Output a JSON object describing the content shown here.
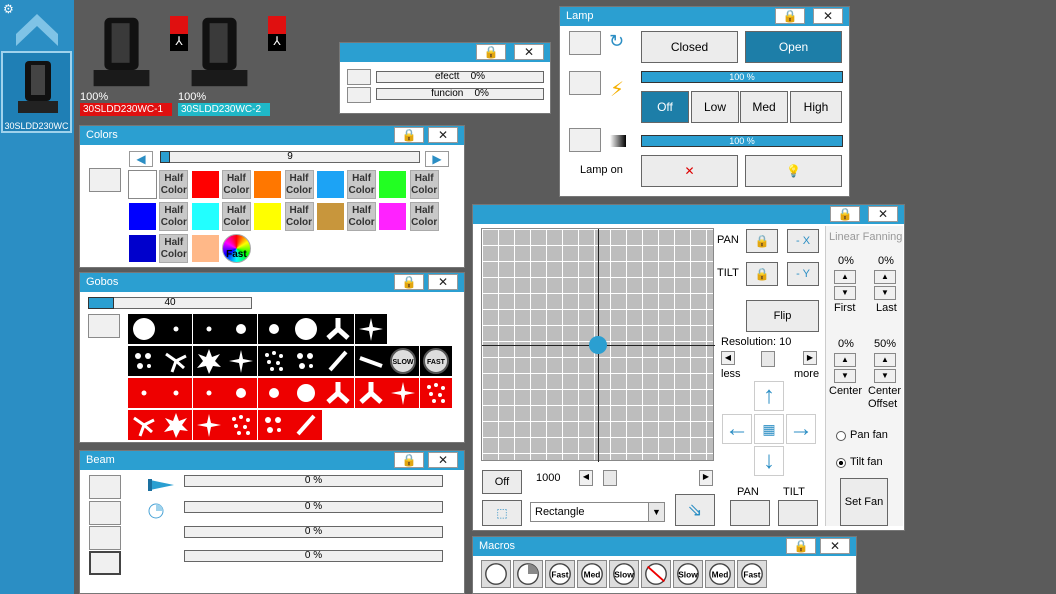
{
  "sidebar": {
    "fixture_label": "30SLDD230WC"
  },
  "fixtures": [
    {
      "percent": "100%",
      "name": "30SLDD230WC-1",
      "color": "#e01010"
    },
    {
      "percent": "100%",
      "name": "30SLDD230WC-2",
      "color": "#1fb8c8"
    }
  ],
  "effects": {
    "rows": [
      {
        "label": "efectt",
        "value": "0%"
      },
      {
        "label": "funcion",
        "value": "0%"
      }
    ]
  },
  "colors": {
    "title": "Colors",
    "value": "9",
    "half_label": "Half\nColor",
    "fast_label": "Fast",
    "swatches": [
      "#ffffff",
      "#ff0000",
      "#ff7700",
      "#1ca3f5",
      "#22ff22",
      "#0000ff",
      "#22ffff",
      "#ffff00",
      "#c8963c",
      "#ff22ff",
      "#0000cc",
      "#ffb888"
    ]
  },
  "gobos": {
    "title": "Gobos",
    "value": "40",
    "slow": "SLOW",
    "fast": "FAST"
  },
  "beam": {
    "title": "Beam",
    "values": [
      "0 %",
      "0 %",
      "0 %",
      "0 %"
    ]
  },
  "lamp": {
    "title": "Lamp",
    "closed": "Closed",
    "open": "Open",
    "bar1": "100 %",
    "bar2": "100 %",
    "off": "Off",
    "low": "Low",
    "med": "Med",
    "high": "High",
    "lamp_on": "Lamp on"
  },
  "pantilt": {
    "pan": "PAN",
    "tilt": "TILT",
    "minus_x": "- X",
    "minus_y": "- Y",
    "flip": "Flip",
    "resolution": "Resolution: 10",
    "less": "less",
    "more": "more",
    "off": "Off",
    "speed": "1000",
    "shape": "Rectangle",
    "pan_bottom": "PAN",
    "tilt_bottom": "TILT"
  },
  "fanning": {
    "title": "Linear Fanning",
    "first_val": "0%",
    "last_val": "0%",
    "first": "First",
    "last": "Last",
    "center_val": "0%",
    "offset_val": "50%",
    "center": "Center",
    "offset": "Center\nOffset",
    "pan_fan": "Pan fan",
    "tilt_fan": "Tilt fan",
    "set_fan": "Set Fan"
  },
  "macros": {
    "title": "Macros",
    "labels": [
      "",
      "",
      "Fast",
      "Med",
      "Slow",
      "",
      "Slow",
      "Med",
      "Fast"
    ]
  }
}
